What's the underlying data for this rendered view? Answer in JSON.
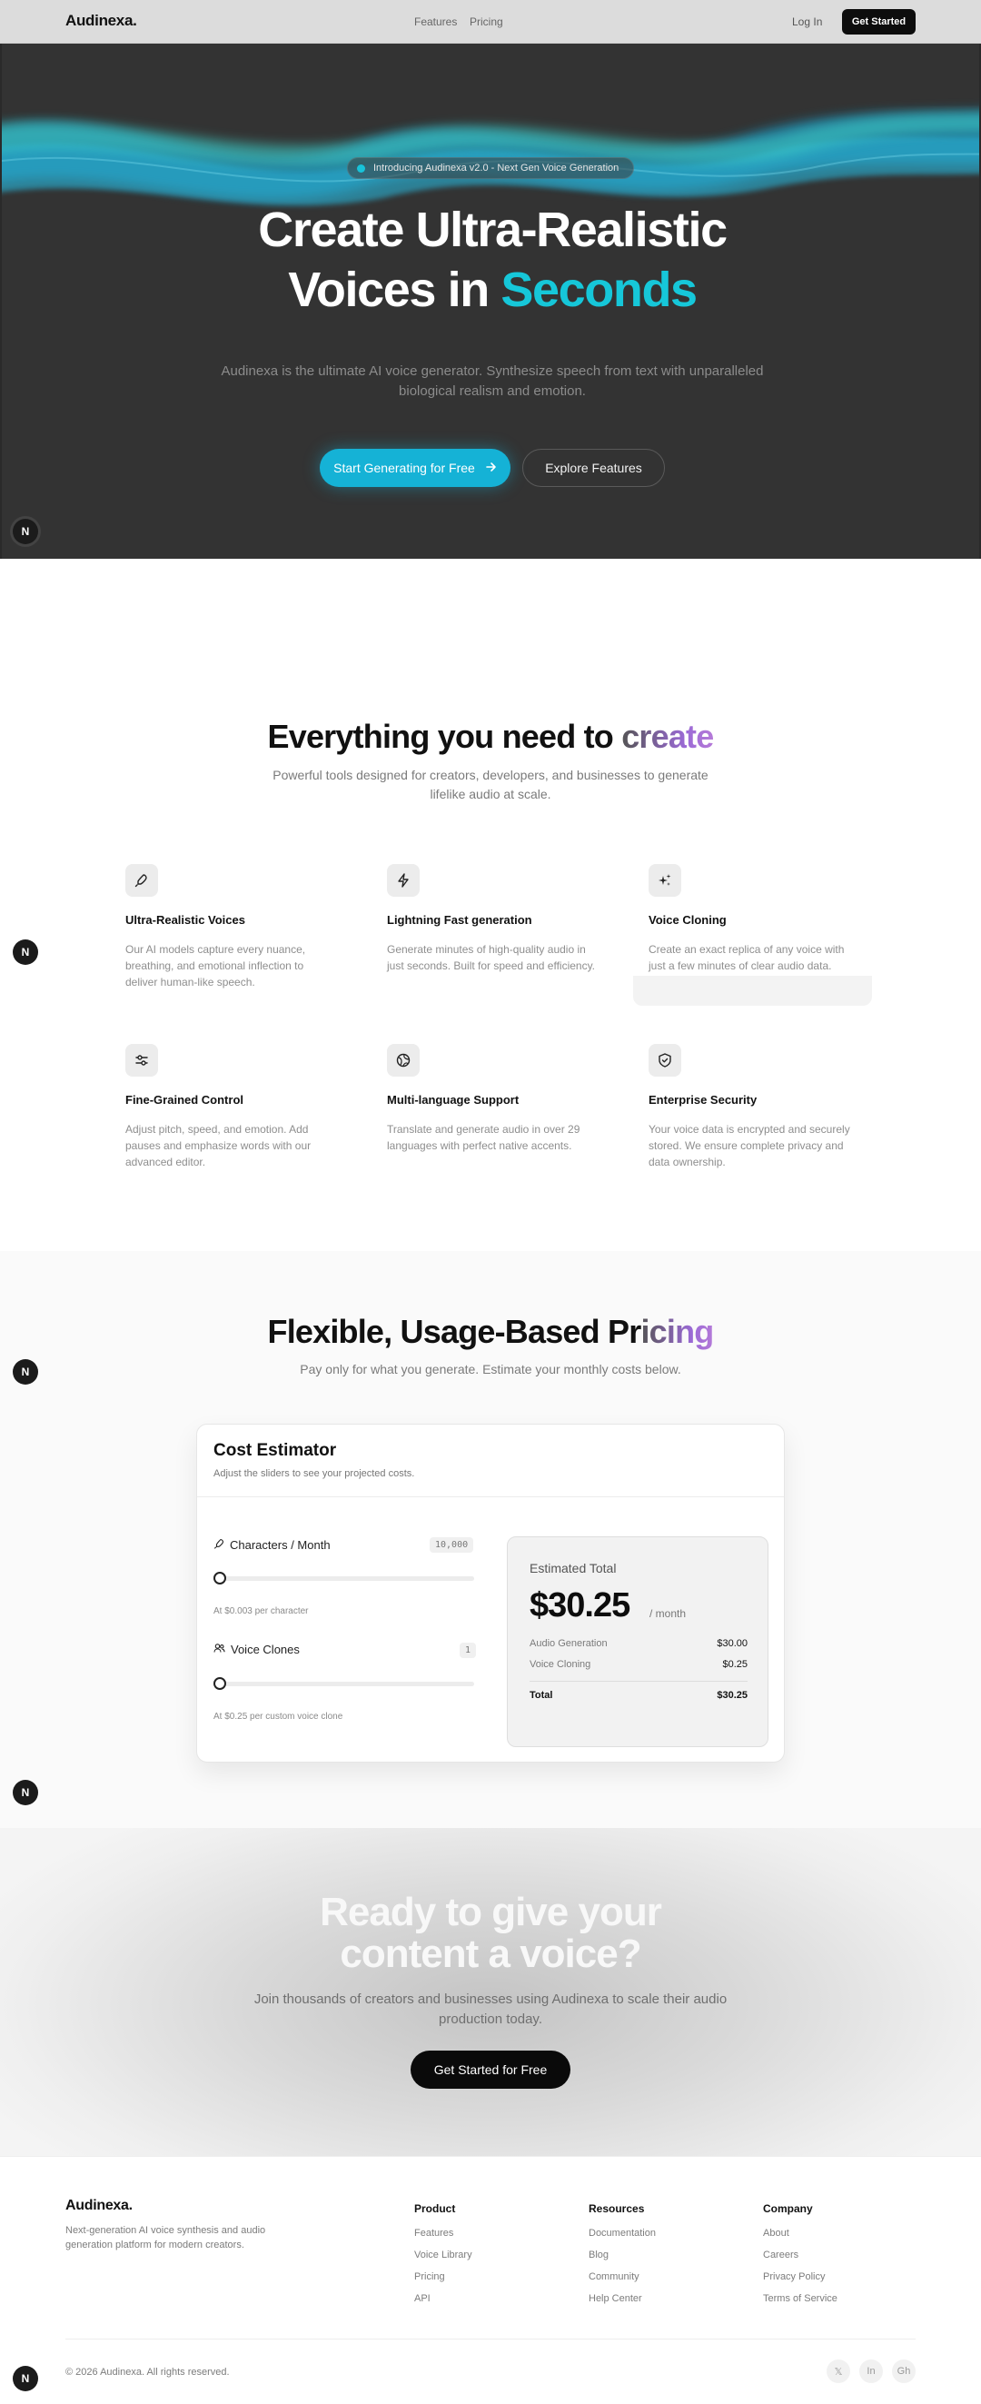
{
  "brand": {
    "name": "Audinexa."
  },
  "nav": {
    "links": [
      "Features",
      "Pricing"
    ],
    "login": "Log In",
    "cta": "Get Started"
  },
  "hero": {
    "badge": "Introducing Audinexa v2.0 - Next Gen Voice Generation",
    "title_line1": "Create Ultra-Realistic",
    "title_line2_prefix": "Voices in",
    "title_line2_accent": "Seconds",
    "subtitle": "Audinexa is the ultimate AI voice generator. Synthesize speech from text with unparalleled biological realism and emotion.",
    "primary_cta": "Start Generating for Free",
    "secondary_cta": "Explore Features"
  },
  "floating_badge": "N",
  "features": {
    "title_prefix": "Everything you need to",
    "title_accent": "create",
    "subtitle": "Powerful tools designed for creators, developers, and businesses to generate lifelike audio at scale.",
    "items": [
      {
        "icon": "microphone-icon",
        "title": "Ultra-Realistic Voices",
        "desc": "Our AI models capture every nuance, breathing, and emotional inflection to deliver human-like speech."
      },
      {
        "icon": "lightning-icon",
        "title": "Lightning Fast generation",
        "desc": "Generate minutes of high-quality audio in just seconds. Built for speed and efficiency."
      },
      {
        "icon": "sparkles-icon",
        "title": "Voice Cloning",
        "desc": "Create an exact replica of any voice with just a few minutes of clear audio data."
      },
      {
        "icon": "sliders-icon",
        "title": "Fine-Grained Control",
        "desc": "Adjust pitch, speed, and emotion. Add pauses and emphasize words with our advanced editor."
      },
      {
        "icon": "globe-icon",
        "title": "Multi-language Support",
        "desc": "Translate and generate audio in over 29 languages with perfect native accents."
      },
      {
        "icon": "shield-icon",
        "title": "Enterprise Security",
        "desc": "Your voice data is encrypted and securely stored. We ensure complete privacy and data ownership."
      }
    ]
  },
  "pricing": {
    "title_prefix": "Flexible, Usage-Based Pr",
    "title_accent": "icing",
    "subtitle": "Pay only for what you generate. Estimate your monthly costs below.",
    "card": {
      "title": "Cost Estimator",
      "subtitle": "Adjust the sliders to see your projected costs.",
      "characters": {
        "label": "Characters / Month",
        "value": "10,000",
        "note": "At $0.003 per character",
        "fraction": 0.0
      },
      "clones": {
        "label": "Voice Clones",
        "value": "1",
        "note": "At $0.25 per custom voice clone",
        "fraction": 0.0
      },
      "summary": {
        "label": "Estimated Total",
        "amount": "$30.25",
        "period": "/ month",
        "rows": [
          {
            "k": "Audio Generation",
            "v": "$30.00"
          },
          {
            "k": "Voice Cloning",
            "v": "$0.25"
          }
        ],
        "total_label": "Total",
        "total_value": "$30.25"
      }
    }
  },
  "cta": {
    "title_line1": "Ready to give your",
    "title_line2": "content a voice?",
    "subtitle": "Join thousands of creators and businesses using Audinexa to scale their audio production today.",
    "button": "Get Started for Free"
  },
  "footer": {
    "brand": "Audinexa.",
    "tagline": "Next-generation AI voice synthesis and audio generation platform for modern creators.",
    "columns": [
      {
        "title": "Product",
        "links": [
          "Features",
          "Voice Library",
          "Pricing",
          "API"
        ]
      },
      {
        "title": "Resources",
        "links": [
          "Documentation",
          "Blog",
          "Community",
          "Help Center"
        ]
      },
      {
        "title": "Company",
        "links": [
          "About",
          "Careers",
          "Privacy Policy",
          "Terms of Service"
        ]
      }
    ],
    "copyright": "© 2026 Audinexa. All rights reserved.",
    "social": [
      "𝕏",
      "In",
      "Gh"
    ]
  },
  "colors": {
    "accent": "#16c7d9",
    "primary_button": "#15b2d6",
    "hero_bg": "#333333",
    "dark": "#0d0d0d",
    "gradient_purple": "#9b6ad6"
  }
}
